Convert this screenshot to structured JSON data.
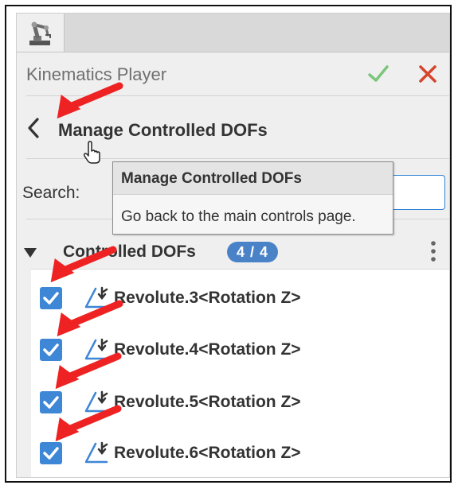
{
  "panel": {
    "tab_icon": "robot-arm-icon",
    "title": "Kinematics Player",
    "ok_icon": "checkmark-icon",
    "close_icon": "close-x-icon",
    "colors": {
      "ok": "#7cc67c",
      "close": "#d5452c",
      "accent": "#4a82c7",
      "annotation_arrow": "#ee2222"
    }
  },
  "header": {
    "back_icon": "chevron-left-icon",
    "title": "Manage Controlled DOFs"
  },
  "search": {
    "label": "Search:",
    "value": ""
  },
  "tooltip": {
    "title": "Manage Controlled DOFs",
    "text": "Go back to the main controls page."
  },
  "section": {
    "label": "Controlled DOFs",
    "count_selected": "4",
    "count_separator": "/",
    "count_total": "4",
    "menu_icon": "vertical-ellipsis-icon"
  },
  "dofs": [
    {
      "label": "Revolute.3<Rotation Z>",
      "checked": true
    },
    {
      "label": "Revolute.4<Rotation Z>",
      "checked": true
    },
    {
      "label": "Revolute.5<Rotation Z>",
      "checked": true
    },
    {
      "label": "Revolute.6<Rotation Z>",
      "checked": true
    }
  ]
}
